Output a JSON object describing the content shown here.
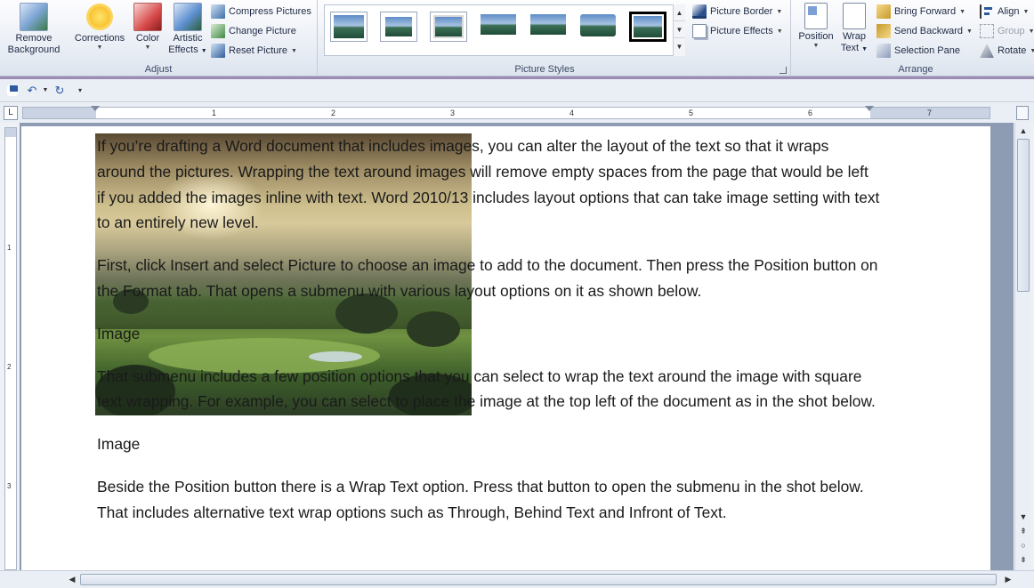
{
  "ribbon": {
    "adjust": {
      "label": "Adjust",
      "remove_background": "Remove Background",
      "remove_background_l1": "Remove",
      "remove_background_l2": "Background",
      "corrections": "Corrections",
      "color": "Color",
      "artistic_l1": "Artistic",
      "artistic_l2": "Effects",
      "compress": "Compress Pictures",
      "change": "Change Picture",
      "reset": "Reset Picture"
    },
    "picture_styles": {
      "label": "Picture Styles",
      "border": "Picture Border",
      "effects": "Picture Effects"
    },
    "arrange": {
      "label": "Arrange",
      "position": "Position",
      "wrap_l1": "Wrap",
      "wrap_l2": "Text",
      "bring_forward": "Bring Forward",
      "send_backward": "Send Backward",
      "selection_pane": "Selection Pane",
      "align": "Align",
      "group": "Group",
      "rotate": "Rotate"
    }
  },
  "ruler": {
    "numbers": [
      "1",
      "2",
      "3",
      "4",
      "5",
      "6",
      "7"
    ],
    "vnumbers": [
      "1",
      "2",
      "3"
    ],
    "tab_marker": "L"
  },
  "document": {
    "paragraphs": [
      "If you’re drafting a Word document that includes images, you can alter the layout of the text so that it wraps around the pictures. Wrapping the text around images will remove empty spaces from the page that would be left if you added the images inline with text. Word 2010/13 includes layout options that can take image setting with text to an entirely new level.",
      "First, click Insert and select Picture to choose an image to add to the document. Then press the Position button on the Format tab. That opens a submenu with various layout options on it as shown below.",
      "Image",
      "That submenu includes a few position options that you can select to wrap the text around the image with square text wrapping. For example, you can select to place the image at the top left of the document as in the shot below.",
      "Image",
      "Beside the Position button there is a Wrap Text option. Press that button to open the submenu in the shot below. That includes alternative text wrap options such as Through, Behind Text and Infront of Text."
    ]
  },
  "colors": {
    "ribbon_bg": "#e7ecf4",
    "accent": "#9b8bb5",
    "doc_bg": "#8e9cb3"
  }
}
